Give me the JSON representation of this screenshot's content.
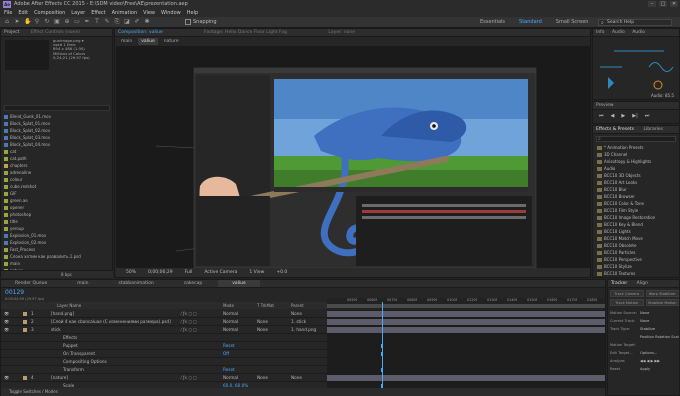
{
  "window": {
    "title": "Adobe After Effects CC 2015 - E:\\SDM video\\Free\\AE\\prezentation.aep",
    "logo": "Ae",
    "controls": [
      "–",
      "□",
      "✕"
    ]
  },
  "menu": [
    "File",
    "Edit",
    "Composition",
    "Layer",
    "Effect",
    "Animation",
    "View",
    "Window",
    "Help"
  ],
  "toolbar": {
    "snapping_label": "Snapping",
    "workspaces": [
      "Essentials",
      "Standard",
      "Small Screen"
    ],
    "active_workspace": "Standard",
    "search_placeholder": "Search Help"
  },
  "project": {
    "header": "Project",
    "effect_controls": "Effect Controls (none)",
    "preview_info": [
      "gunimage.png ▾",
      "used 1 time",
      "894 x 486 (1.00)",
      "Millions of Colors",
      "0;24;21 (29.97 fps)"
    ],
    "rows": [
      {
        "name": "Blend_Gunk_01.mov",
        "color": "#4b79b5"
      },
      {
        "name": "Block_Splat_01.mov",
        "color": "#4b79b5"
      },
      {
        "name": "Block_Splat_02.mov",
        "color": "#4b79b5"
      },
      {
        "name": "Block_Splat_03.mov",
        "color": "#4b79b5"
      },
      {
        "name": "Block_Splat_04.mov",
        "color": "#4b79b5"
      },
      {
        "name": "cat",
        "color": "#9aa63c"
      },
      {
        "name": "cat.path",
        "color": "#9aa63c"
      },
      {
        "name": "chapters",
        "color": "#c8a04a"
      },
      {
        "name": "adrenaline",
        "color": "#9aa63c"
      },
      {
        "name": "colour",
        "color": "#9aa63c"
      },
      {
        "name": "cube.redshot",
        "color": "#9aa63c"
      },
      {
        "name": "GIF",
        "color": "#9aa63c"
      },
      {
        "name": "green.ae",
        "color": "#9aa63c"
      },
      {
        "name": "opener",
        "color": "#9aa63c"
      },
      {
        "name": "photoshop",
        "color": "#9aa63c"
      },
      {
        "name": "title",
        "color": "#9aa63c"
      },
      {
        "name": "yeroup",
        "color": "#9aa63c"
      },
      {
        "name": "Explosion_01.mov",
        "color": "#4b79b5"
      },
      {
        "name": "Explosion_02.mov",
        "color": "#4b79b5"
      },
      {
        "name": "Fast_Process",
        "color": "#9aa63c"
      },
      {
        "name": "Слона хотим как развалить.1.psd",
        "color": "#9aa63c"
      },
      {
        "name": "main",
        "color": "#9aa63c"
      },
      {
        "name": "nature",
        "color": "#9aa63c"
      },
      {
        "name": "Hairy 4...F [Full HD].PSD",
        "color": "#9aa63c"
      },
      {
        "name": "pro",
        "color": "#c8a04a"
      },
      {
        "name": "Picture 1",
        "color": "#9aa63c"
      }
    ],
    "bpc": "8 bpc"
  },
  "composition": {
    "header": "Composition: valiue",
    "tabs": [
      "main",
      "valiue",
      "nature"
    ],
    "active_tab": "valiue",
    "footage_label": "Footage: Hello Dance Floor Light Fog",
    "layer_label": "Layer: none",
    "footer": {
      "zoom": "50%",
      "timecode": "0;00;06;29",
      "quality": "Full",
      "camera": "Active Camera",
      "views": "1 View",
      "offset": "+0.0"
    }
  },
  "info_panel": {
    "tabs": [
      "Info",
      "Audio",
      "Audio"
    ],
    "active_tab": "Audio",
    "value": "Audio: 85.5"
  },
  "preview": {
    "header": "Preview"
  },
  "effects": {
    "tabs": [
      "Effects & Presets",
      "Libraries"
    ],
    "search_placeholder": "",
    "items": [
      "* Animation Presets",
      "3D Channel",
      "Anisotropy & Highlights",
      "Audio",
      "BCC10 3D Objects",
      "BCC10 Art Looks",
      "BCC10 Blur",
      "BCC10 Browser",
      "BCC10 Color & Tone",
      "BCC10 Film Style",
      "BCC10 Image Restoration",
      "BCC10 Key & Blend",
      "BCC10 Lights",
      "BCC10 Match Move",
      "BCC10 Obsolete",
      "BCC10 Particles",
      "BCC10 Perspective",
      "BCC10 Stylize",
      "BCC10 Textures",
      "BCC10 Time",
      "BCC10 Transitions"
    ]
  },
  "timeline": {
    "tabs": [
      "Render Queue",
      "main",
      "stabbanimation",
      "cakecap",
      "valiue"
    ],
    "active_tab": "valiue",
    "timecode": "00129",
    "timecode_sub": "0:00:04:09 (29.97 fps)",
    "columns": [
      "Layer Name",
      "Mode",
      "T TrkMat",
      "Parent"
    ],
    "ruler": [
      "",
      "0050f",
      "0060f",
      "0070f",
      "0080f",
      "0090f",
      "0100f",
      "0120f",
      "0130f",
      "0140f",
      "0150f",
      "0160f",
      "0170f",
      "0180f"
    ],
    "layers": [
      {
        "num": "1",
        "name": "[hand.png]",
        "mode": "Normal",
        "trkmat": "",
        "parent": "None",
        "color": "#b5a06b"
      },
      {
        "num": "2",
        "name": "[Слой 4 как cbancaluae (С изменениями размера).psd]",
        "mode": "Normal",
        "trkmat": "None",
        "parent": "1. stick",
        "color": "#b5a06b"
      },
      {
        "num": "3",
        "name": "stick",
        "mode": "Normal",
        "trkmat": "None",
        "parent": "1. hand.png",
        "color": "#b5a06b"
      },
      {
        "num": "",
        "name": "Effects",
        "mode": "",
        "trkmat": "",
        "parent": "",
        "color": ""
      },
      {
        "num": "",
        "name": "Puppet",
        "mode": "Reset",
        "trkmat": "",
        "parent": "",
        "color": ""
      },
      {
        "num": "",
        "name": "On Transparent",
        "mode": "Off",
        "trkmat": "",
        "parent": "",
        "color": ""
      },
      {
        "num": "",
        "name": "Compositing Options",
        "mode": "",
        "trkmat": "",
        "parent": "",
        "color": ""
      },
      {
        "num": "",
        "name": "Transform",
        "mode": "Reset",
        "trkmat": "",
        "parent": "",
        "color": ""
      },
      {
        "num": "4",
        "name": "[nature]",
        "mode": "Normal",
        "trkmat": "None",
        "parent": "None",
        "color": "#b5a06b"
      },
      {
        "num": "",
        "name": "Scale",
        "mode": "60.0, 60.0%",
        "trkmat": "",
        "parent": "",
        "color": ""
      },
      {
        "num": "5",
        "name": "[Слой 0/4.psd]",
        "mode": "Normal",
        "trkmat": "None",
        "parent": "None",
        "color": "#b5a06b"
      }
    ],
    "footer": "Toggle Switches / Modes"
  },
  "tracker": {
    "tabs": [
      "Tracker",
      "Align"
    ],
    "buttons": [
      "Track Camera",
      "Warp Stabilizer",
      "Track Motion",
      "Stabilize Motion"
    ],
    "rows": [
      {
        "label": "Motion Source:",
        "value": "None"
      },
      {
        "label": "Current Track:",
        "value": "None"
      },
      {
        "label": "Track Type:",
        "value": "Stabilize"
      },
      {
        "label": "",
        "value": "Position  Rotation  Scale"
      },
      {
        "label": "Motion Target:",
        "value": ""
      },
      {
        "label": "Edit Target...",
        "value": "Options..."
      },
      {
        "label": "Analyze:",
        "value": "◀◀  ◀  ▶  ▶▶"
      },
      {
        "label": "Reset",
        "value": "Apply"
      }
    ]
  }
}
